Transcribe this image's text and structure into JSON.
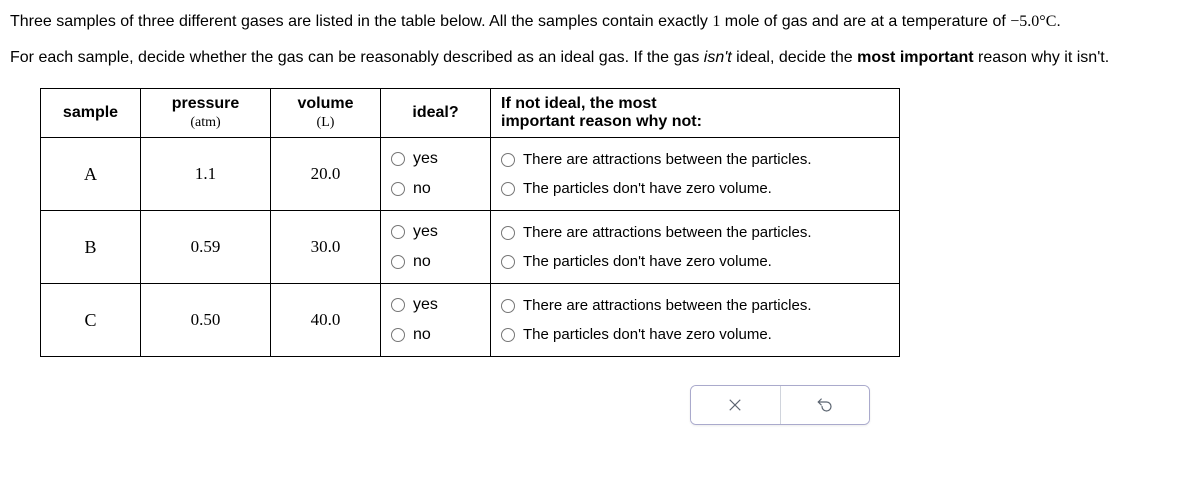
{
  "intro": {
    "para1_prefix": "Three samples of three different gases are listed in the table below. All the samples contain exactly ",
    "moles": "1",
    "para1_mid": " mole of gas and are at a temperature of ",
    "temperature": "−5.0°C",
    "para1_suffix": ".",
    "para2_prefix": "For each sample, decide whether the gas can be reasonably described as an ideal gas. If the gas ",
    "isnt": "isn't",
    "para2_mid": " ideal, decide the ",
    "mostimp": "most important",
    "para2_suffix": " reason why it isn't."
  },
  "headers": {
    "sample": "sample",
    "pressure": "pressure",
    "pressure_unit": "(atm)",
    "volume": "volume",
    "volume_unit": "(L)",
    "ideal": "ideal?",
    "reason_line1": "If not ideal, the most",
    "reason_line2": "important reason why not:"
  },
  "labels": {
    "yes": "yes",
    "no": "no",
    "attractions": "There are attractions between the particles.",
    "zerovolume": "The particles don't have zero volume."
  },
  "rows": [
    {
      "sample": "A",
      "pressure": "1.1",
      "volume": "20.0"
    },
    {
      "sample": "B",
      "pressure": "0.59",
      "volume": "30.0"
    },
    {
      "sample": "C",
      "pressure": "0.50",
      "volume": "40.0"
    }
  ]
}
